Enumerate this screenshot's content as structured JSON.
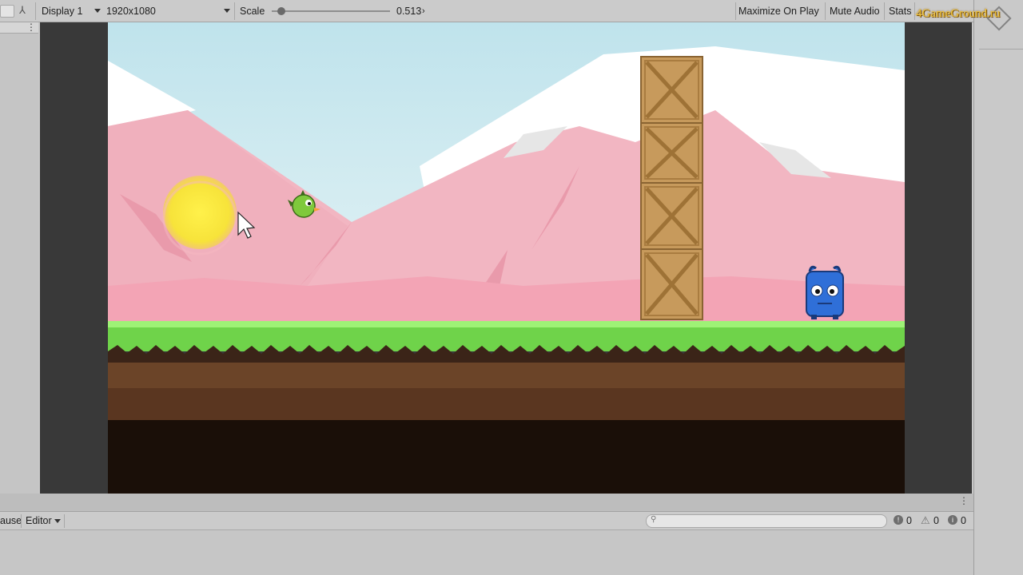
{
  "toolbar": {
    "display": "Display 1",
    "resolution": "1920x1080",
    "scale_label": "Scale",
    "scale_value": "0.513",
    "scale_fraction": 0.05,
    "maximize": "Maximize On Play",
    "mute": "Mute Audio",
    "stats": "Stats"
  },
  "watermark": "4GameGround.ru",
  "console": {
    "pause_label": "ause",
    "editor_label": "Editor",
    "search_placeholder": "",
    "errors": "0",
    "warnings": "0",
    "messages": "0"
  },
  "colors": {
    "sky": "#dff0f4",
    "mountain": "#f2b3bf",
    "grass": "#6fd34a",
    "dirt": "#6b4428"
  }
}
